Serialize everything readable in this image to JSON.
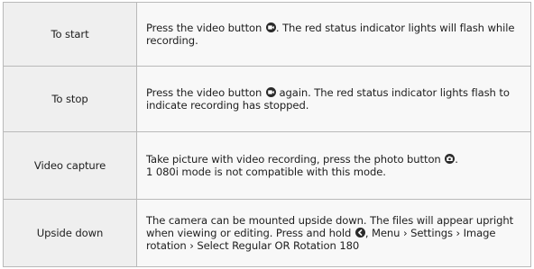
{
  "rows": [
    {
      "label": "To start",
      "desc_a": "Press the video button",
      "desc_b": ". The red status indicator lights will flash while recording.",
      "icon": "video-record-icon"
    },
    {
      "label": "To stop",
      "desc_a": "Press the video button",
      "desc_b": " again. The red status indicator lights flash to indicate recording has stopped.",
      "icon": "video-record-icon"
    },
    {
      "label": "Video capture",
      "desc_a": "Take picture with video recording, press the photo button",
      "desc_b": ".",
      "desc_c": "1 080i mode is not compatible with this mode.",
      "icon": "photo-camera-icon"
    },
    {
      "label": "Upside down",
      "desc_a": "The camera can be mounted upside down. The files will appear upright when viewing or editing. Press and hold",
      "desc_b": ", Menu › Settings › Image rotation › Select Regular OR Rotation 180",
      "icon": "back-arrow-icon"
    }
  ]
}
